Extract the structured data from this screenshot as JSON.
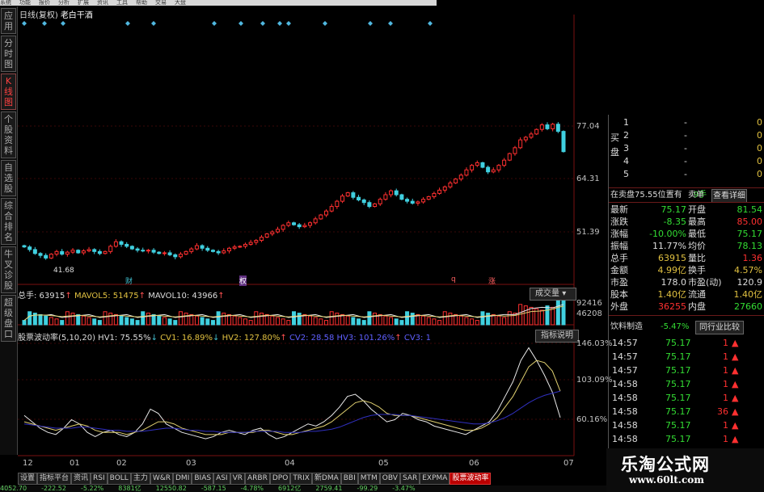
{
  "menu": [
    "系统",
    "功能",
    "报价",
    "分析",
    "扩展",
    "资讯",
    "工具",
    "帮助",
    "交易",
    "大盘"
  ],
  "sidebar": [
    {
      "label": "应用",
      "active": false
    },
    {
      "label": "分时图",
      "active": false
    },
    {
      "label": "K线图",
      "active": true
    },
    {
      "label": "个股资料",
      "active": false
    },
    {
      "label": "自选股",
      "active": false
    },
    {
      "label": "综合排名",
      "active": false
    },
    {
      "label": "牛叉诊股",
      "active": false
    },
    {
      "label": "超级盘口",
      "active": false
    }
  ],
  "header": {
    "period": "日线(复权)",
    "stock_name": "老白干酒"
  },
  "price_axis": [
    "77.04",
    "64.31",
    "51.39"
  ],
  "low_label": "41.68",
  "markers": [
    "财",
    "权",
    "q",
    "涨"
  ],
  "volume_info": {
    "total": "总手: 63915",
    "ma5": "MAVOL5: 51475",
    "ma10": "MAVOL10: 43966",
    "dropdown": "成交量",
    "axis": [
      "92416",
      "46208"
    ]
  },
  "indicator_info": {
    "name": "股票波动率(5,10,20)",
    "hv1": "HV1: 75.55%",
    "cv1": "CV1: 16.89%",
    "hv2": "HV2: 127.80%",
    "cv2": "CV2: 28.58",
    "hv3": "HV3: 101.26%",
    "cv3": "CV3: 1",
    "button": "指标说明",
    "axis": [
      "146.03%",
      "103.09%",
      "60.16%"
    ]
  },
  "date_axis": [
    "12",
    "01",
    "02",
    "03",
    "04",
    "05",
    "06",
    "07"
  ],
  "bottom_tabs": [
    {
      "label": "设置",
      "active": false
    },
    {
      "label": "指标平台",
      "active": false
    },
    {
      "label": "资讯",
      "active": false
    },
    {
      "label": "RSI",
      "active": false
    },
    {
      "label": "BOLL",
      "active": false
    },
    {
      "label": "主力",
      "active": false
    },
    {
      "label": "W&R",
      "active": false
    },
    {
      "label": "DMI",
      "active": false
    },
    {
      "label": "BIAS",
      "active": false
    },
    {
      "label": "ASI",
      "active": false
    },
    {
      "label": "VR",
      "active": false
    },
    {
      "label": "ARBR",
      "active": false
    },
    {
      "label": "DPO",
      "active": false
    },
    {
      "label": "TRIX",
      "active": false
    },
    {
      "label": "新DMA",
      "active": false
    },
    {
      "label": "BBI",
      "active": false
    },
    {
      "label": "MTM",
      "active": false
    },
    {
      "label": "OBV",
      "active": false
    },
    {
      "label": "SAR",
      "active": false
    },
    {
      "label": "EXPMA",
      "active": false
    },
    {
      "label": "股票波动率",
      "active": true
    }
  ],
  "bottom_status": [
    "4052.70",
    "-222.52",
    "-5.22%",
    "8381亿",
    "12550.82",
    "-587.15",
    "-4.78%",
    "6912亿",
    "2759.41",
    "-99.29",
    "-3.47%"
  ],
  "quote_panel": {
    "buy_label": "买盘",
    "order_levels": [
      {
        "level": "1",
        "price": "-",
        "vol": "0"
      },
      {
        "level": "2",
        "price": "-",
        "vol": "0"
      },
      {
        "level": "3",
        "price": "-",
        "vol": "0"
      },
      {
        "level": "4",
        "price": "-",
        "vol": "0"
      },
      {
        "level": "5",
        "price": "-",
        "vol": "0"
      }
    ],
    "sell_note": "在卖盘75.55位置有",
    "sell_qty": "9手",
    "sell_btn": "卖单",
    "detail_btn": "查看详细",
    "stats": [
      {
        "l1": "最新",
        "v1": "75.17",
        "c1": "g",
        "l2": "开盘",
        "v2": "81.54",
        "c2": "g"
      },
      {
        "l1": "涨跌",
        "v1": "-8.35",
        "c1": "g",
        "l2": "最高",
        "v2": "85.00",
        "c2": "r"
      },
      {
        "l1": "涨幅",
        "v1": "-10.00%",
        "c1": "g",
        "l2": "最低",
        "v2": "75.17",
        "c2": "g"
      },
      {
        "l1": "振幅",
        "v1": "11.77%",
        "c1": "w",
        "l2": "均价",
        "v2": "78.13",
        "c2": "g"
      },
      {
        "l1": "总手",
        "v1": "63915",
        "c1": "y",
        "l2": "量比",
        "v2": "1.36",
        "c2": "r"
      },
      {
        "l1": "金额",
        "v1": "4.99亿",
        "c1": "y",
        "l2": "换手",
        "v2": "4.57%",
        "c2": "y"
      },
      {
        "l1": "市盈",
        "v1": "178.0",
        "c1": "w",
        "l2": "市盈(动)",
        "v2": "120.9",
        "c2": "w"
      },
      {
        "l1": "股本",
        "v1": "1.40亿",
        "c1": "y",
        "l2": "流通",
        "v2": "1.40亿",
        "c2": "y"
      },
      {
        "l1": "外盘",
        "v1": "36255",
        "c1": "r",
        "l2": "内盘",
        "v2": "27660",
        "c2": "g"
      }
    ],
    "sector": {
      "name": "饮料制造",
      "change": "-5.47%",
      "button": "同行业比较"
    },
    "trades": [
      {
        "time": "14:57",
        "price": "75.17",
        "vol": "1"
      },
      {
        "time": "14:57",
        "price": "75.17",
        "vol": "1"
      },
      {
        "time": "14:57",
        "price": "75.17",
        "vol": "1"
      },
      {
        "time": "14:58",
        "price": "75.17",
        "vol": "1"
      },
      {
        "time": "14:58",
        "price": "75.17",
        "vol": "1"
      },
      {
        "time": "14:58",
        "price": "75.17",
        "vol": "36"
      },
      {
        "time": "14:58",
        "price": "75.17",
        "vol": "1"
      },
      {
        "time": "14:58",
        "price": "75.17",
        "vol": "1"
      },
      {
        "time": "14:58",
        "price": "75.17",
        "vol": "1"
      }
    ]
  },
  "watermark": {
    "title": "乐淘公式网",
    "url": "www.60lt.com"
  },
  "colors": {
    "up": "#ff3030",
    "down": "#40d0e0",
    "white_line": "#e8e8e8",
    "yellow_line": "#e0d070",
    "blue_line": "#3030c0",
    "grid": "#7a1010"
  },
  "chart_data": {
    "type": "candlestick",
    "categories": [
      "12",
      "01",
      "02",
      "03",
      "04",
      "05",
      "06",
      "07"
    ],
    "close": [
      46.0,
      45.2,
      44.0,
      43.4,
      42.6,
      43.8,
      44.6,
      43.8,
      44.4,
      45.0,
      44.2,
      44.8,
      45.2,
      44.6,
      44.0,
      44.6,
      46.2,
      47.6,
      46.8,
      46.2,
      45.4,
      45.0,
      44.8,
      45.0,
      44.4,
      44.0,
      44.2,
      43.6,
      43.0,
      43.8,
      44.6,
      45.4,
      46.4,
      45.6,
      45.0,
      44.6,
      44.2,
      44.8,
      45.6,
      46.0,
      46.2,
      46.8,
      47.4,
      48.0,
      49.0,
      50.0,
      50.6,
      51.4,
      52.6,
      53.4,
      52.8,
      52.2,
      52.6,
      53.4,
      54.6,
      55.8,
      57.0,
      58.4,
      60.0,
      61.6,
      62.6,
      61.2,
      60.4,
      59.6,
      58.4,
      59.2,
      60.6,
      62.0,
      63.2,
      62.0,
      60.6,
      60.0,
      59.4,
      59.8,
      60.6,
      61.4,
      62.4,
      63.4,
      64.4,
      65.6,
      66.8,
      68.0,
      69.6,
      71.0,
      71.8,
      70.4,
      69.0,
      69.6,
      71.0,
      72.6,
      74.6,
      76.4,
      78.8,
      79.6,
      80.6,
      82.0,
      83.4,
      82.2,
      83.6,
      81.4,
      75.2
    ],
    "series": [
      {
        "name": "HV1",
        "values": [
          0.78,
          0.72,
          0.66,
          0.62,
          0.6,
          0.66,
          0.74,
          0.7,
          0.62,
          0.58,
          0.62,
          0.64,
          0.6,
          0.58,
          0.62,
          0.7,
          0.84,
          0.8,
          0.7,
          0.66,
          0.62,
          0.6,
          0.58,
          0.56,
          0.58,
          0.62,
          0.64,
          0.62,
          0.6,
          0.64,
          0.66,
          0.6,
          0.56,
          0.58,
          0.62,
          0.66,
          0.7,
          0.68,
          0.72,
          0.78,
          0.86,
          0.96,
          0.98,
          0.92,
          0.84,
          0.78,
          0.72,
          0.74,
          0.8,
          0.78,
          0.74,
          0.72,
          0.68,
          0.66,
          0.64,
          0.62,
          0.6,
          0.64,
          0.68,
          0.72,
          0.82,
          0.96,
          1.1,
          1.3,
          1.42,
          1.3,
          1.16,
          1.0,
          0.76
        ]
      },
      {
        "name": "HV2",
        "values": [
          0.72,
          0.7,
          0.68,
          0.66,
          0.64,
          0.66,
          0.68,
          0.7,
          0.68,
          0.64,
          0.62,
          0.62,
          0.62,
          0.6,
          0.62,
          0.64,
          0.68,
          0.72,
          0.72,
          0.7,
          0.66,
          0.64,
          0.62,
          0.6,
          0.6,
          0.6,
          0.62,
          0.62,
          0.62,
          0.62,
          0.64,
          0.64,
          0.62,
          0.6,
          0.6,
          0.62,
          0.64,
          0.66,
          0.68,
          0.72,
          0.78,
          0.84,
          0.9,
          0.92,
          0.9,
          0.86,
          0.8,
          0.78,
          0.78,
          0.78,
          0.76,
          0.74,
          0.72,
          0.7,
          0.68,
          0.66,
          0.64,
          0.64,
          0.66,
          0.7,
          0.76,
          0.86,
          0.96,
          1.1,
          1.24,
          1.3,
          1.28,
          1.2,
          1.01
        ]
      },
      {
        "name": "HV3",
        "values": [
          0.7,
          0.69,
          0.68,
          0.67,
          0.66,
          0.66,
          0.66,
          0.67,
          0.67,
          0.66,
          0.65,
          0.64,
          0.64,
          0.63,
          0.63,
          0.63,
          0.64,
          0.65,
          0.66,
          0.66,
          0.65,
          0.64,
          0.64,
          0.63,
          0.63,
          0.62,
          0.62,
          0.62,
          0.62,
          0.63,
          0.63,
          0.63,
          0.63,
          0.62,
          0.62,
          0.62,
          0.63,
          0.63,
          0.64,
          0.65,
          0.67,
          0.7,
          0.73,
          0.76,
          0.78,
          0.79,
          0.79,
          0.79,
          0.78,
          0.78,
          0.77,
          0.76,
          0.75,
          0.74,
          0.73,
          0.72,
          0.71,
          0.7,
          0.7,
          0.71,
          0.73,
          0.76,
          0.8,
          0.85,
          0.9,
          0.94,
          0.97,
          0.99,
          1.01
        ]
      }
    ]
  }
}
